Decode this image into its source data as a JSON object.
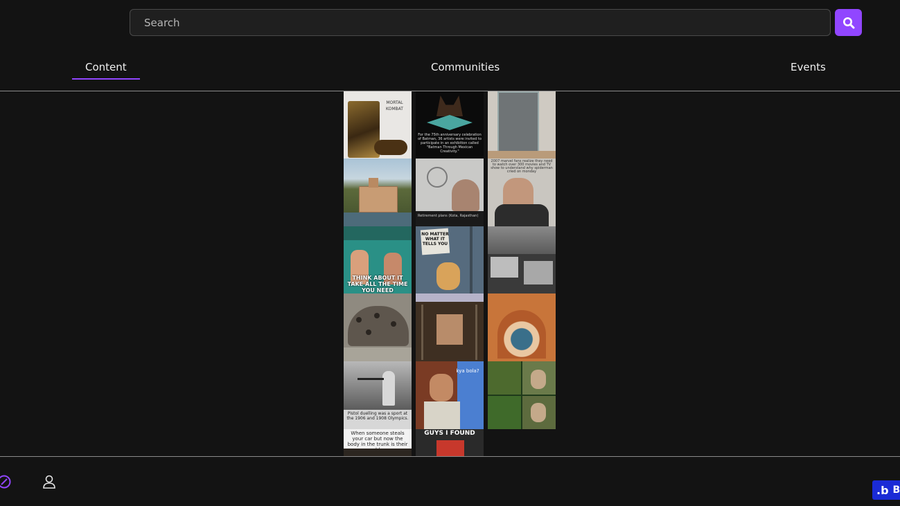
{
  "search": {
    "placeholder": "Search"
  },
  "tabs": [
    {
      "label": "Content",
      "active": true
    },
    {
      "label": "Communities",
      "active": false
    },
    {
      "label": "Events",
      "active": false
    }
  ],
  "feed": {
    "tiles": [
      {
        "id": "a1",
        "caption": "MORTAL KOMBAT"
      },
      {
        "id": "b1",
        "caption": "For the 75th anniversary celebration of Batman, 36 artists were invited to participate in an exhibition called \"Batman Through Mexican Creativity.\""
      },
      {
        "id": "c1",
        "caption": "2007 marvel fans realize they need to watch over 300 movies and TV show to understand why spiderman cried on monday"
      },
      {
        "id": "b2",
        "caption": "Retirement plans (Kota, Rajasthan)"
      },
      {
        "id": "a3",
        "caption": "THINK ABOUT IT TAKE ALL THE TIME YOU NEED"
      },
      {
        "id": "b3",
        "caption": "NO MATTER WHAT IT TELLS YOU"
      },
      {
        "id": "b5",
        "caption": "kya bola?"
      },
      {
        "id": "a5",
        "caption": "Pistol duelling was a sport at the 1906 and 1908 Olympics."
      },
      {
        "id": "a6",
        "caption": "When someone steals your car but now the body in the trunk is their problem"
      },
      {
        "id": "b6",
        "caption": "GUYS I FOUND"
      }
    ]
  },
  "bottom_nav": {
    "discover_icon": "compass-icon",
    "profile_icon": "user-icon"
  },
  "badge": {
    "label": "B"
  },
  "colors": {
    "accent": "#9146ff",
    "background": "#131313",
    "badge": "#1a2bd6"
  }
}
